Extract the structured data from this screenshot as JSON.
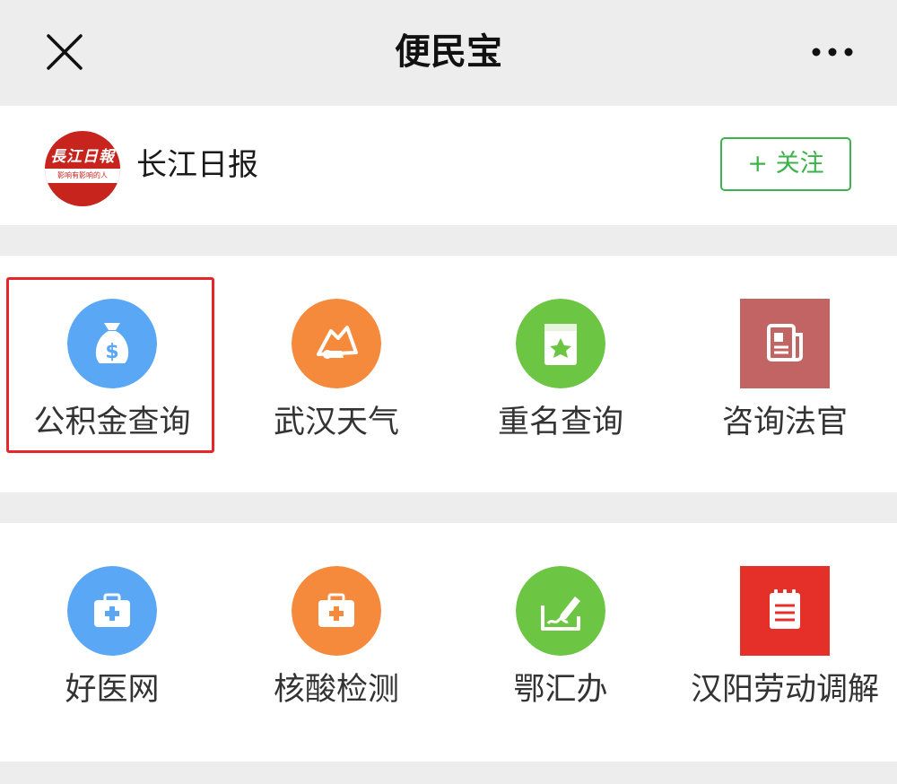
{
  "header": {
    "title": "便民宝",
    "close_icon": "close-icon",
    "more_icon": "more-dots-icon"
  },
  "publisher": {
    "name": "长江日报",
    "logo_text": "長江日報",
    "logo_subtext": "影响有影响的人",
    "follow_label": "+ 关注",
    "accent": "#3cb34a",
    "logo_color": "#c8241e"
  },
  "services": {
    "row1": [
      {
        "label": "公积金查询",
        "icon": "money-bag-icon",
        "color": "#5aa8f5",
        "highlighted": true
      },
      {
        "label": "武汉天气",
        "icon": "weather-icon",
        "color": "#f58a3c"
      },
      {
        "label": "重名查询",
        "icon": "star-card-icon",
        "color": "#6cc644"
      },
      {
        "label": "咨询法官",
        "icon": "newspaper-icon",
        "color": "#c26464"
      }
    ],
    "row2": [
      {
        "label": "好医网",
        "icon": "medical-kit-icon",
        "color": "#5aa8f5"
      },
      {
        "label": "核酸检测",
        "icon": "medical-kit-icon",
        "color": "#f58a3c"
      },
      {
        "label": "鄂汇办",
        "icon": "sign-pen-icon",
        "color": "#6cc644"
      },
      {
        "label": "汉阳劳动调解",
        "icon": "notepad-icon",
        "color": "#e5302a"
      }
    ]
  }
}
